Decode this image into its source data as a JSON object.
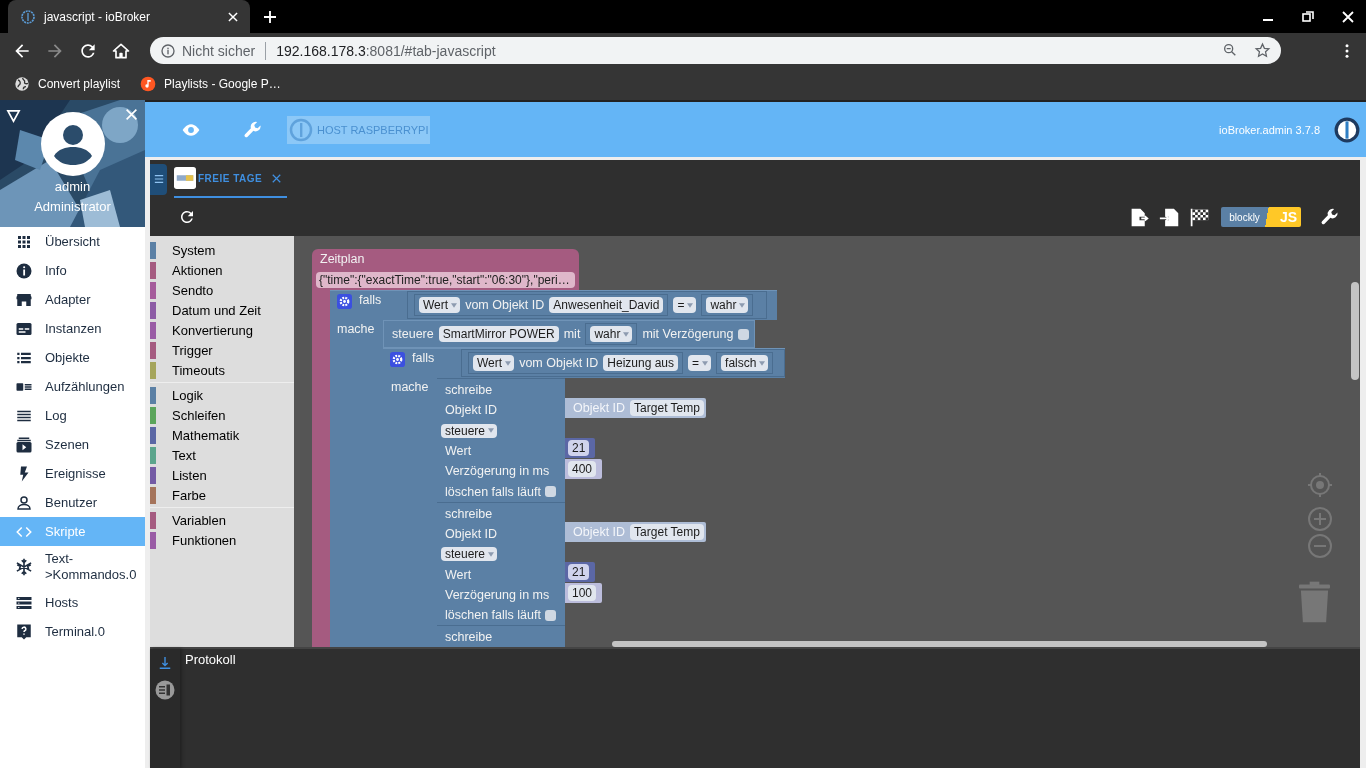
{
  "browser": {
    "tab": {
      "title": "javascript - ioBroker",
      "selected": true
    },
    "address": {
      "security": "Nicht sicher",
      "host": "192.168.178.3",
      "path": ":8081/#tab-javascript"
    },
    "bookmarks": [
      {
        "label": "Convert playlist"
      },
      {
        "label": "Playlists - Google P…"
      }
    ]
  },
  "sidebar": {
    "user": "admin",
    "role": "Administrator",
    "items": [
      {
        "label": "Übersicht",
        "selected": false
      },
      {
        "label": "Info",
        "selected": false
      },
      {
        "label": "Adapter",
        "selected": false
      },
      {
        "label": "Instanzen",
        "selected": false
      },
      {
        "label": "Objekte",
        "selected": false
      },
      {
        "label": "Aufzählungen",
        "selected": false
      },
      {
        "label": "Log",
        "selected": false
      },
      {
        "label": "Szenen",
        "selected": false
      },
      {
        "label": "Ereignisse",
        "selected": false
      },
      {
        "label": "Benutzer",
        "selected": false
      },
      {
        "label": "Skripte",
        "selected": true
      },
      {
        "label": "Text->Kommandos.0",
        "selected": false
      },
      {
        "label": "Hosts",
        "selected": false
      },
      {
        "label": "Terminal.0",
        "selected": false
      }
    ]
  },
  "header": {
    "host": {
      "label": "HOST RASPBERRYPI",
      "disabled": true
    },
    "version": "ioBroker.admin 3.7.8"
  },
  "editor": {
    "tabs": [
      {
        "label": "FREIE TAGE",
        "selected": true
      }
    ],
    "mode": {
      "blockly": "blockly",
      "js": "JS"
    },
    "toolbox": [
      [
        {
          "label": "System",
          "color": "#5b80a5",
          "selected": false
        },
        {
          "label": "Aktionen",
          "color": "#a55b80",
          "selected": false
        },
        {
          "label": "Sendto",
          "color": "#a55b9b",
          "selected": false
        },
        {
          "label": "Datum und Zeit",
          "color": "#8c5ba5",
          "selected": false
        },
        {
          "label": "Konvertierung",
          "color": "#995ba5",
          "selected": false
        },
        {
          "label": "Trigger",
          "color": "#a55b80",
          "selected": false
        },
        {
          "label": "Timeouts",
          "color": "#a5a55b",
          "selected": false
        }
      ],
      [
        {
          "label": "Logik",
          "color": "#5b80a5",
          "selected": false
        },
        {
          "label": "Schleifen",
          "color": "#5ba55b",
          "selected": false
        },
        {
          "label": "Mathematik",
          "color": "#5b67a5",
          "selected": false
        },
        {
          "label": "Text",
          "color": "#5ba58c",
          "selected": false
        },
        {
          "label": "Listen",
          "color": "#745ba5",
          "selected": false
        },
        {
          "label": "Farbe",
          "color": "#a5745b",
          "selected": false
        }
      ],
      [
        {
          "label": "Variablen",
          "color": "#a55b80",
          "selected": false
        },
        {
          "label": "Funktionen",
          "color": "#995ba5",
          "selected": false
        }
      ]
    ],
    "workspace": {
      "schedule": {
        "title": "Zeitplan",
        "value": "{\"time\":{\"exactTime\":true,\"start\":\"06:30\"},\"peri…"
      },
      "if_blocks": [
        {
          "label": "falls",
          "do_label": "mache",
          "condition": {
            "field": "Wert",
            "text": "vom Objekt ID",
            "object": "Anwesenheit_David",
            "operator": "=",
            "value": "wahr"
          }
        },
        {
          "label": "falls",
          "do_label": "mache",
          "condition": {
            "field": "Wert",
            "text": "vom Objekt ID",
            "object": "Heizung aus",
            "operator": "=",
            "value": "falsch"
          }
        }
      ],
      "control": {
        "label": "steuere",
        "object": "SmartMirror POWER",
        "with_label": "mit",
        "value": "wahr",
        "delay_label": "mit Verzögerung",
        "delay": false
      },
      "writes": [
        {
          "title": "schreibe",
          "id_label": "Objekt ID",
          "object_label": "Objekt ID",
          "object": "Target Temp",
          "mode": "steuere",
          "value_label": "Wert",
          "value": "21",
          "delay_label": "Verzögerung in ms",
          "delay": "400",
          "clear_label": "löschen falls läuft",
          "clear": false
        },
        {
          "title": "schreibe",
          "id_label": "Objekt ID",
          "object_label": "Objekt ID",
          "object": "Target Temp",
          "mode": "steuere",
          "value_label": "Wert",
          "value": "21",
          "delay_label": "Verzögerung in ms",
          "delay": "100",
          "clear_label": "löschen falls läuft",
          "clear": false
        },
        {
          "title": "schreibe"
        }
      ]
    }
  },
  "log": {
    "title": "Protokoll"
  }
}
